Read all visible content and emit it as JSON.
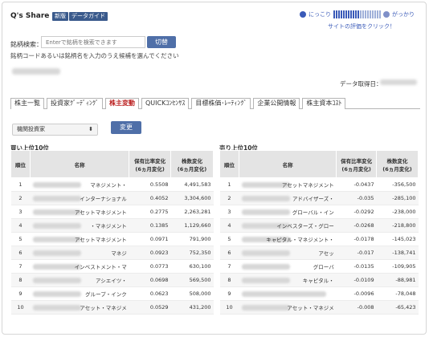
{
  "header": {
    "brand": "Q's Share",
    "badge_new": "新版",
    "badge_guide": "データガイド",
    "rating_good": "にっこり",
    "rating_bad": "がっかり",
    "rating_note": "サイトの評価をクリック！"
  },
  "search": {
    "label": "銘柄検索：",
    "placeholder": "Enterで銘柄を検索できます",
    "button": "切替",
    "hint": "銘柄コードあるいは銘柄名を入力のうえ候補を選んでください"
  },
  "data_date_label": "データ取得日：",
  "tabs": [
    {
      "label": "株主一覧",
      "active": false
    },
    {
      "label": "投資家ｸﾞｰﾃﾞｨﾝｸﾞ",
      "active": false
    },
    {
      "label": "株主変動",
      "active": true
    },
    {
      "label": "QUICKｺﾝｾﾝｻｽ",
      "active": false
    },
    {
      "label": "目標株価･ﾚｰﾃｨﾝｸﾞ",
      "active": false
    },
    {
      "label": "企業公開情報",
      "active": false
    },
    {
      "label": "株主資本ｺｽﾄ",
      "active": false
    }
  ],
  "filter": {
    "selected": "機関投資家",
    "button": "変更"
  },
  "buy": {
    "title": "買い上位10位",
    "headers": [
      "順位",
      "名称",
      "保有比率変化\n(6ヵ月変化)",
      "株数変化\n(6ヵ月変化)"
    ],
    "rows": [
      {
        "rank": "1",
        "name": "マネジメント・",
        "ratio": "0.5508",
        "shares": "4,491,583"
      },
      {
        "rank": "2",
        "name": "インターナショナル",
        "ratio": "0.4052",
        "shares": "3,304,600"
      },
      {
        "rank": "3",
        "name": "アセットマネジメント",
        "ratio": "0.2775",
        "shares": "2,263,281"
      },
      {
        "rank": "4",
        "name": "・マネジメント",
        "ratio": "0.1385",
        "shares": "1,129,660"
      },
      {
        "rank": "5",
        "name": "アセットマネジメント",
        "ratio": "0.0971",
        "shares": "791,900"
      },
      {
        "rank": "6",
        "name": "マネジ",
        "ratio": "0.0923",
        "shares": "752,350"
      },
      {
        "rank": "7",
        "name": "インベストメント・マ",
        "ratio": "0.0773",
        "shares": "630,100"
      },
      {
        "rank": "8",
        "name": "アシエイツ・",
        "ratio": "0.0698",
        "shares": "569,500"
      },
      {
        "rank": "9",
        "name": "グループ・インク",
        "ratio": "0.0623",
        "shares": "508,000"
      },
      {
        "rank": "10",
        "name": "アセット・マネジメ",
        "ratio": "0.0529",
        "shares": "431,200"
      }
    ]
  },
  "sell": {
    "title": "売り上位10位",
    "headers": [
      "順位",
      "名称",
      "保有比率変化\n(6ヵ月変化)",
      "株数変化\n(6ヵ月変化)"
    ],
    "rows": [
      {
        "rank": "1",
        "name": "アセットマネジメント",
        "ratio": "-0.0437",
        "shares": "-356,500"
      },
      {
        "rank": "2",
        "name": "アドバイザーズ・",
        "ratio": "-0.035",
        "shares": "-285,100"
      },
      {
        "rank": "3",
        "name": "グローバル・イン",
        "ratio": "-0.0292",
        "shares": "-238,000"
      },
      {
        "rank": "4",
        "name": "インベスターズ・グロー",
        "ratio": "-0.0268",
        "shares": "-218,800"
      },
      {
        "rank": "5",
        "name": "キャピタル・マネジメント・",
        "ratio": "-0.0178",
        "shares": "-145,023"
      },
      {
        "rank": "6",
        "name": "アセッ",
        "ratio": "-0.017",
        "shares": "-138,741"
      },
      {
        "rank": "7",
        "name": "グローバ",
        "ratio": "-0.0135",
        "shares": "-109,905"
      },
      {
        "rank": "8",
        "name": "キャピタル・",
        "ratio": "-0.0109",
        "shares": "-88,981"
      },
      {
        "rank": "9",
        "name": "",
        "ratio": "-0.0096",
        "shares": "-78,048"
      },
      {
        "rank": "10",
        "name": "アセット・マネジメ",
        "ratio": "-0.008",
        "shares": "-65,423"
      }
    ]
  }
}
